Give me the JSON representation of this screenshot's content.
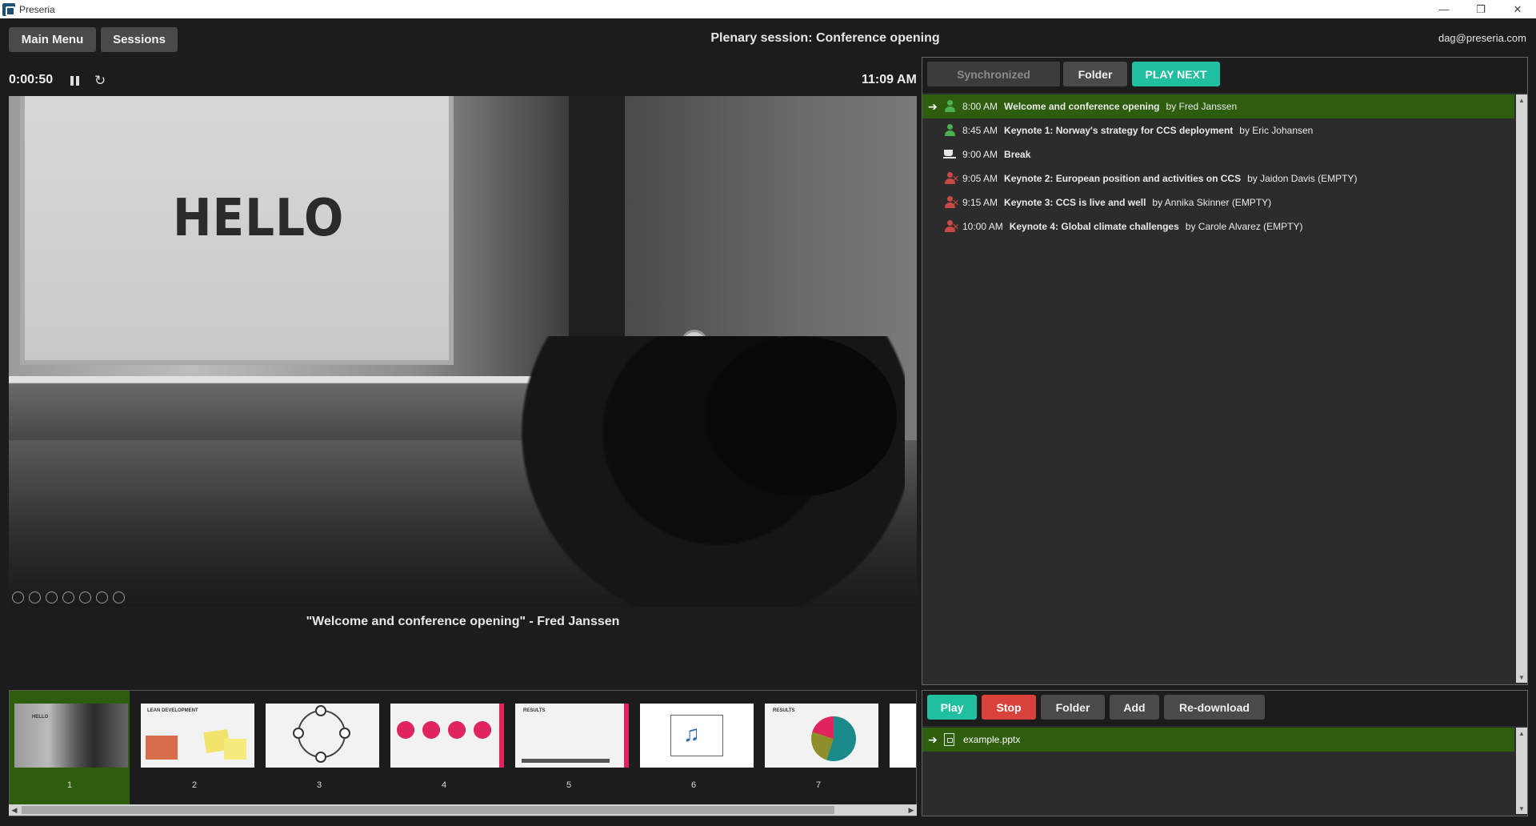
{
  "window": {
    "title": "Preseria",
    "minimize": "—",
    "restore": "❐",
    "close": "✕"
  },
  "topbar": {
    "main_menu": "Main Menu",
    "sessions": "Sessions",
    "session_title": "Plenary session: Conference opening",
    "user": "dag@preseria.com"
  },
  "player": {
    "elapsed": "0:00:50",
    "clock": "11:09 AM",
    "slide_text": "HELLO",
    "caption": "\"Welcome and conference opening\" - Fred Janssen"
  },
  "thumbnails": [
    {
      "number": "1",
      "title": "HELLO",
      "active": true
    },
    {
      "number": "2",
      "title": "LEAN DEVELOPMENT",
      "active": false
    },
    {
      "number": "3",
      "title": "",
      "active": false
    },
    {
      "number": "4",
      "title": "",
      "active": false
    },
    {
      "number": "5",
      "title": "RESULTS",
      "active": false
    },
    {
      "number": "6",
      "title": "",
      "active": false
    },
    {
      "number": "7",
      "title": "RESULTS",
      "active": false
    }
  ],
  "schedule": {
    "tabs": {
      "synchronized": "Synchronized",
      "folder": "Folder",
      "play_next": "PLAY NEXT"
    },
    "items": [
      {
        "time": "8:00 AM",
        "title": "Welcome and conference opening",
        "by": "by  Fred Janssen",
        "icon": "person-icon",
        "current": true
      },
      {
        "time": "8:45 AM",
        "title": "Keynote 1: Norway's strategy for CCS deployment",
        "by": "by  Eric Johansen",
        "icon": "person-icon",
        "current": false
      },
      {
        "time": "9:00 AM",
        "title": "Break",
        "by": "",
        "icon": "coffee-cup-icon",
        "current": false
      },
      {
        "time": "9:05 AM",
        "title": "Keynote 2: European position and activities on CCS",
        "by": "by  Jaidon Davis (EMPTY)",
        "icon": "person-missing-icon",
        "current": false
      },
      {
        "time": "9:15 AM",
        "title": "Keynote 3: CCS is live and well",
        "by": "by  Annika Skinner (EMPTY)",
        "icon": "person-missing-icon",
        "current": false
      },
      {
        "time": "10:00 AM",
        "title": "Keynote 4: Global climate challenges",
        "by": "by  Carole Alvarez (EMPTY)",
        "icon": "person-missing-icon",
        "current": false
      }
    ]
  },
  "files": {
    "buttons": {
      "play": "Play",
      "stop": "Stop",
      "folder": "Folder",
      "add": "Add",
      "redownload": "Re-download"
    },
    "items": [
      {
        "name": "example.pptx",
        "current": true
      }
    ]
  },
  "colors": {
    "accent_green": "#2e5d0e",
    "play_next": "#1fbf9f",
    "stop_red": "#d9423b",
    "missing_red": "#c94a44",
    "present_green": "#4caf50"
  }
}
